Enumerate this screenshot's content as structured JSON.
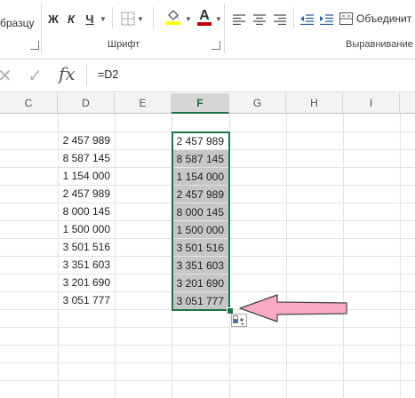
{
  "ribbon": {
    "clipboard_partial": "бразцу",
    "bold": "Ж",
    "italic": "К",
    "underline": "Ч",
    "font_group_label": "Шрифт",
    "merge_label": "Объединит",
    "align_group_label": "Выравнивание",
    "font_color": "#c00000",
    "fill_color": "#ffff00"
  },
  "formula_bar": {
    "cancel_icon": "x-icon",
    "enter_icon": "check-icon",
    "fx_label": "fx",
    "formula": "=D2"
  },
  "columns": [
    "C",
    "D",
    "E",
    "F",
    "G",
    "H",
    "I"
  ],
  "selected_column": "F",
  "column_d_values": [
    "2 457 989",
    "8 587 145",
    "1 154 000",
    "2 457 989",
    "8 000 145",
    "1 500 000",
    "3 501 516",
    "3 351 603",
    "3 201 690",
    "3 051 777"
  ],
  "column_f_values": [
    "2 457 989",
    "8 587 145",
    "1 154 000",
    "2 457 989",
    "8 000 145",
    "1 500 000",
    "3 501 516",
    "3 351 603",
    "3 201 690",
    "3 051 777"
  ],
  "colors": {
    "selection": "#217346",
    "arrow_fill": "#f8aac4"
  }
}
